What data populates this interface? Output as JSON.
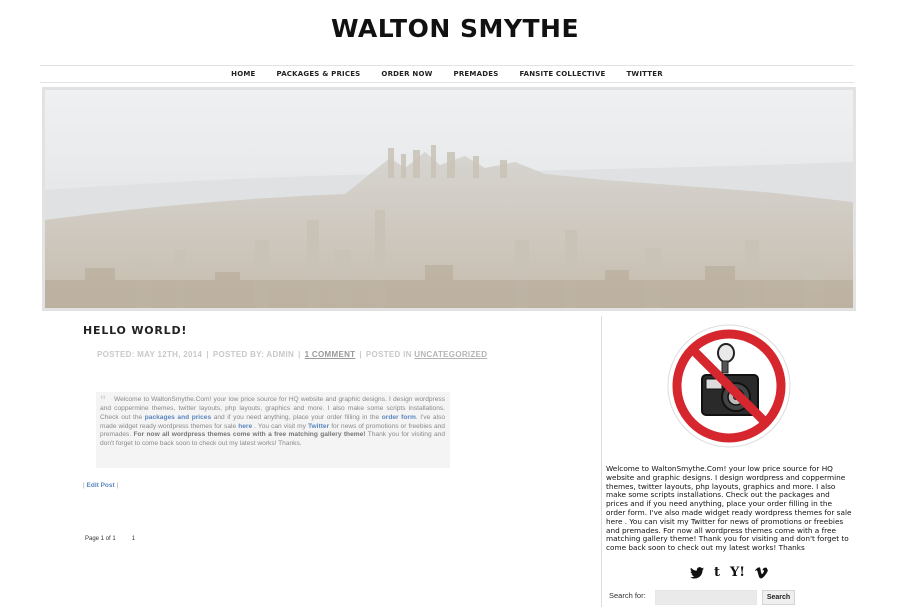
{
  "site": {
    "title": "WALTON SMYTHE"
  },
  "nav": {
    "items": [
      {
        "label": "HOME"
      },
      {
        "label": "PACKAGES & PRICES"
      },
      {
        "label": "ORDER NOW"
      },
      {
        "label": "PREMADES"
      },
      {
        "label": "FANSITE COLLECTIVE"
      },
      {
        "label": "TWITTER"
      }
    ]
  },
  "post": {
    "title": "HELLO WORLD!",
    "meta": {
      "posted": "POSTED: MAY 12TH, 2014",
      "by": "POSTED BY: ADMIN",
      "comments": "1 COMMENT",
      "in_label": "POSTED IN",
      "category": "UNCATEGORIZED"
    },
    "quote": {
      "mark": "\"",
      "p1": "Welcome to WaltonSmythe.Com! your low price source for HQ website and graphic designs. I design wordpress and coppermine themes, twitter layouts, php layouts, graphics and more. I also make some scripts installations. Check out the",
      "link_packages": "packages and prices",
      "p2": "and if you need anything, place your order filling in the",
      "link_order": "order form",
      "p3": ". I've also made widget ready wordpress themes for sale",
      "link_here": "here",
      "p4": ". You can visit my",
      "link_twitter": "Twitter",
      "p5": "for news of promotions or freebies and premades.",
      "strong_text": "For now all wordpress themes come with a free matching gallery theme!",
      "p6": "Thank you for visiting and don't forget to come back soon to check out my latest works! Thanks."
    },
    "edit": {
      "pipe_left": "|",
      "label": "Edit Post",
      "pipe_right": "|"
    }
  },
  "pagination": {
    "label": "Page 1 of 1",
    "page": "1"
  },
  "sidebar": {
    "text": "Welcome to WaltonSmythe.Com! your low price source for HQ website and graphic designs. I design wordpress and coppermine themes, twitter layouts, php layouts, graphics and more. I also make some scripts installations. Check out the packages and prices and if you need anything, place your order filling in the order form. I've also made widget ready wordpress themes for sale here . You can visit my Twitter for news of promotions or freebies and premades. For now all wordpress themes come with a free matching gallery theme! Thank you for visiting and don't forget to come back soon to check out my latest works! Thanks",
    "social": [
      "twitter-icon",
      "tumblr-icon",
      "yahoo-icon",
      "vimeo-icon"
    ],
    "social_glyphs": {
      "tumblr": "t",
      "yahoo": "Y!"
    },
    "search": {
      "label": "Search for:",
      "value": "",
      "button": "Search"
    }
  },
  "colors": {
    "link": "#5a87c0",
    "no_sign": "#d6262e",
    "meta": "#c8c8c8"
  }
}
